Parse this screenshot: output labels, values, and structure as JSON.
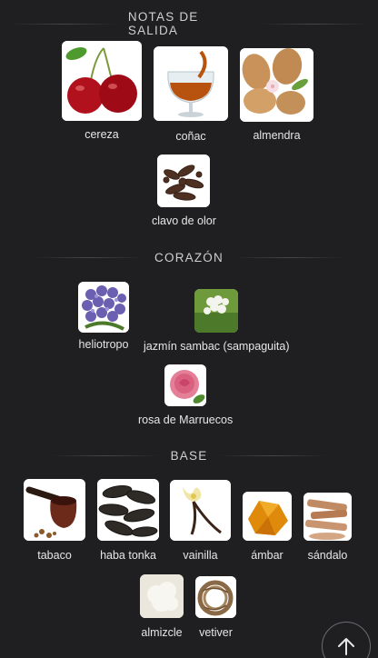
{
  "sections": {
    "top": {
      "title": "NOTAS DE SALIDA"
    },
    "heart": {
      "title": "CORAZÓN"
    },
    "base": {
      "title": "BASE"
    }
  },
  "notes": {
    "cereza": "cereza",
    "conac": "coñac",
    "almendra": "almendra",
    "clavo": "clavo de olor",
    "heliotropo": "heliotropo",
    "jazmin": "jazmín sambac (sampaguita)",
    "rosa": "rosa de Marruecos",
    "tabaco": "tabaco",
    "haba": "haba tonka",
    "vainilla": "vainilla",
    "ambar": "ámbar",
    "sandalo": "sándalo",
    "almizcle": "almizcle",
    "vetiver": "vetiver"
  },
  "icons": {
    "scroll_top": "arrow-up-icon"
  },
  "colors": {
    "background": "#1f1f22",
    "text": "#e6e6e6"
  }
}
